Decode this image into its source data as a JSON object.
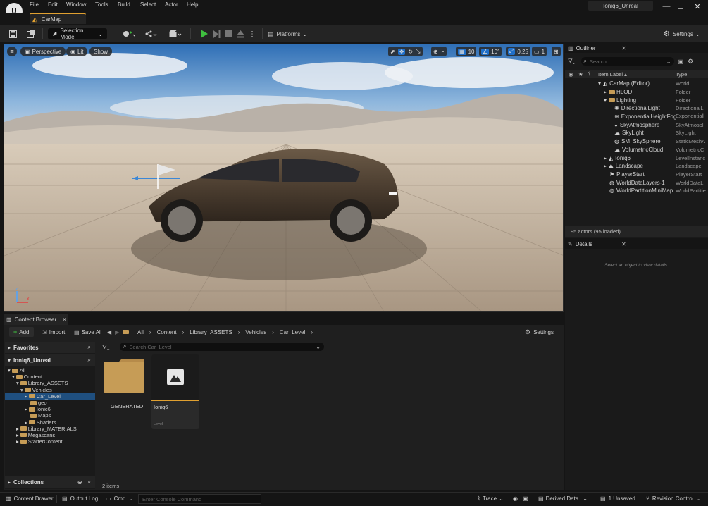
{
  "app": {
    "project_name": "Ioniq6_Unreal",
    "logo_text": "U"
  },
  "menu": [
    "File",
    "Edit",
    "Window",
    "Tools",
    "Build",
    "Select",
    "Actor",
    "Help"
  ],
  "window_controls": {
    "minimize": "—",
    "maximize": "☐",
    "close": "✕"
  },
  "level_tab": {
    "label": "CarMap"
  },
  "toolbar": {
    "selection_mode": "Selection Mode",
    "platforms": "Platforms",
    "settings": "Settings"
  },
  "viewport": {
    "perspective": "Perspective",
    "lit": "Lit",
    "show": "Show",
    "grid_snap": "10",
    "rotation_snap": "10°",
    "scale_snap": "0.25",
    "camera_speed": "1",
    "axis_x": "x",
    "axis_z": "z"
  },
  "outliner": {
    "title": "Outliner",
    "search_placeholder": "Search...",
    "col_label": "Item Label ▴",
    "col_type": "Type",
    "items": [
      {
        "label": "CarMap (Editor)",
        "type": "World",
        "icon": "world-icon"
      },
      {
        "label": "HLOD",
        "type": "Folder",
        "icon": "folder-icon"
      },
      {
        "label": "Lighting",
        "type": "Folder",
        "icon": "folder-icon"
      },
      {
        "label": "DirectionalLight",
        "type": "DirectionalL",
        "icon": "sun-icon"
      },
      {
        "label": "ExponentialHeightFog",
        "type": "Exponentiall",
        "icon": "fog-icon"
      },
      {
        "label": "SkyAtmosphere",
        "type": "SkyAtmospl",
        "icon": "atmosphere-icon"
      },
      {
        "label": "SkyLight",
        "type": "SkyLight",
        "icon": "skylight-icon"
      },
      {
        "label": "SM_SkySphere",
        "type": "StaticMeshA",
        "icon": "sphere-icon"
      },
      {
        "label": "VolumetricCloud",
        "type": "VolumetricC",
        "icon": "cloud-icon"
      },
      {
        "label": "Ioniq6",
        "type": "LevelInstanc",
        "icon": "level-instance-icon"
      },
      {
        "label": "Landscape",
        "type": "Landscape",
        "icon": "landscape-icon"
      },
      {
        "label": "PlayerStart",
        "type": "PlayerStart",
        "icon": "flag-icon"
      },
      {
        "label": "WorldDataLayers-1",
        "type": "WorldDataL",
        "icon": "globe-icon"
      },
      {
        "label": "WorldPartitionMiniMap",
        "type": "WorldPartitie",
        "icon": "globe-icon"
      }
    ],
    "status": "95 actors (95 loaded)"
  },
  "details": {
    "title": "Details",
    "empty_text": "Select an object to view details."
  },
  "content_browser": {
    "tab_label": "Content Browser",
    "add": "Add",
    "import": "Import",
    "save_all": "Save All",
    "breadcrumb": [
      "All",
      "Content",
      "Library_ASSETS",
      "Vehicles",
      "Car_Level"
    ],
    "settings": "Settings",
    "search_placeholder": "Search Car_Level",
    "favorites": "Favorites",
    "project": "Ioniq6_Unreal",
    "collections": "Collections",
    "tree": [
      {
        "label": "All"
      },
      {
        "label": "Content"
      },
      {
        "label": "Library_ASSETS"
      },
      {
        "label": "Vehicles"
      },
      {
        "label": "Car_Level"
      },
      {
        "label": "geo"
      },
      {
        "label": "Ionic6"
      },
      {
        "label": "Maps"
      },
      {
        "label": "Shaders"
      },
      {
        "label": "Library_MATERIALS"
      },
      {
        "label": "Megascans"
      },
      {
        "label": "StarterContent"
      }
    ],
    "assets": [
      {
        "name": "_GENERATED",
        "kind": "folder"
      },
      {
        "name": "Ioniq6",
        "kind": "Level"
      }
    ],
    "item_count": "2 items"
  },
  "statusbar": {
    "content_drawer": "Content Drawer",
    "output_log": "Output Log",
    "cmd": "Cmd",
    "console_placeholder": "Enter Console Command",
    "trace": "Trace",
    "derived_data": "Derived Data",
    "unsaved": "1 Unsaved",
    "revision_control": "Revision Control"
  },
  "colors": {
    "accent_orange": "#e0a030",
    "play_green": "#3fbf3f",
    "selection_blue": "#1f4f7f"
  }
}
